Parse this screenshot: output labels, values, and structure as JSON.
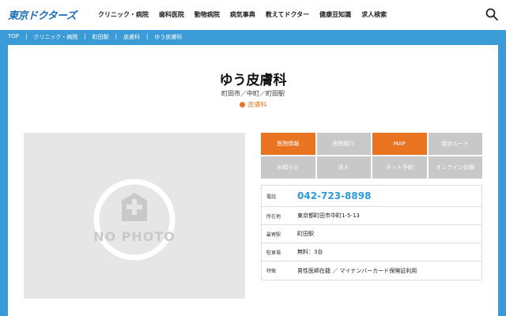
{
  "header": {
    "logo": "東京ドクターズ",
    "nav": [
      "クリニック・病院",
      "歯科医院",
      "動物病院",
      "病気事典",
      "教えてドクター",
      "健康豆知識",
      "求人検索"
    ]
  },
  "breadcrumb": [
    "TOP",
    "クリニック・病院",
    "町田駅",
    "皮膚科",
    "ゆう皮膚科"
  ],
  "clinic": {
    "name": "ゆう皮膚科",
    "location": "町田市／中町／町田駅",
    "category": "皮膚科"
  },
  "photo": {
    "placeholder": "NO PHOTO"
  },
  "tabs": [
    {
      "label": "医院情報",
      "active": true
    },
    {
      "label": "医院紹介",
      "active": false
    },
    {
      "label": "MAP",
      "active": true
    },
    {
      "label": "徒歩ルート",
      "active": false
    },
    {
      "label": "お知らせ",
      "active": false
    },
    {
      "label": "求人",
      "active": false
    },
    {
      "label": "ネット予約",
      "active": false
    },
    {
      "label": "オンライン診療",
      "active": false
    }
  ],
  "info": {
    "phone_label": "電話",
    "phone": "042-723-8898",
    "address_label": "所在地",
    "address": "東京都町田市中町1-5-13",
    "station_label": "最寄駅",
    "station": "町田駅",
    "parking_label": "駐車場",
    "parking": "無料：3台",
    "features_label": "特徴",
    "features": "男性医師在籍 ／ マイナンバーカード保険証利用"
  },
  "colors": {
    "accent": "#e87422",
    "brand": "#3b9bd6",
    "phone": "#2b9ad6"
  }
}
